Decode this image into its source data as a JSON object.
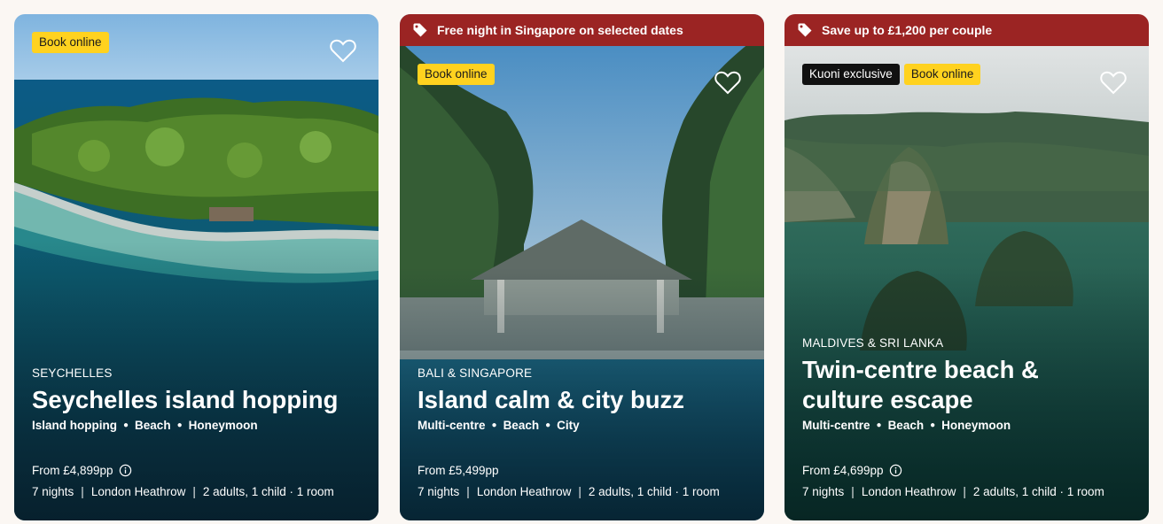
{
  "cards": [
    {
      "banner": "",
      "badges": [
        "Book online"
      ],
      "kicker": "SEYCHELLES",
      "title_lines": [
        "Seychelles island hopping",
        ""
      ],
      "tags": [
        "Island hopping",
        "Beach",
        "Honeymoon"
      ],
      "price": "From £4,899pp",
      "nights": "7 nights",
      "airport": "London Heathrow",
      "party": "2 adults, 1 child · 1 room",
      "icons": {
        "heart": "heart-outline-icon",
        "info": "info-icon"
      }
    },
    {
      "banner": "Free night in Singapore on selected dates",
      "badges": [
        "Book online"
      ],
      "kicker": "BALI & SINGAPORE",
      "title_lines": [
        "Island calm & city buzz",
        ""
      ],
      "tags": [
        "Multi-centre",
        "Beach",
        "City"
      ],
      "price": "From £5,499pp",
      "nights": "7 nights",
      "airport": "London Heathrow",
      "party": "2 adults, 1 child · 1 room",
      "icons": {
        "heart": "heart-outline-icon",
        "tag": "tag-icon"
      }
    },
    {
      "banner": "Save up to £1,200 per couple",
      "badges": [
        "Kuoni exclusive",
        "Book online"
      ],
      "kicker": "MALDIVES & SRI LANKA",
      "title_lines": [
        "Twin-centre beach &",
        "culture escape"
      ],
      "tags": [
        "Multi-centre",
        "Beach",
        "Honeymoon"
      ],
      "price": "From £4,699pp",
      "nights": "7 nights",
      "airport": "London Heathrow",
      "party": "2 adults, 1 child · 1 room",
      "icons": {
        "heart": "heart-outline-icon",
        "tag": "tag-icon",
        "info": "info-icon"
      }
    }
  ],
  "colors": {
    "banner": "#9b2423",
    "badge_yellow": "#ffd21f",
    "background": "#fbf7f3"
  }
}
